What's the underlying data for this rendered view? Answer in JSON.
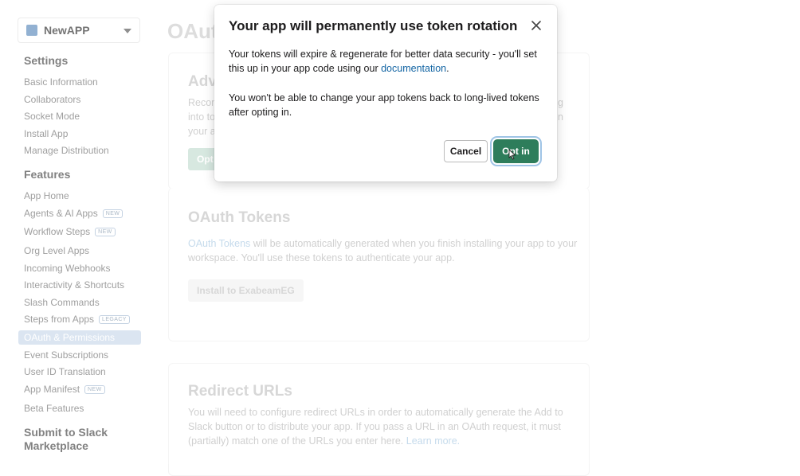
{
  "sidebar": {
    "app_name": "NewAPP",
    "settings_heading": "Settings",
    "settings_items": [
      "Basic Information",
      "Collaborators",
      "Socket Mode",
      "Install App",
      "Manage Distribution"
    ],
    "features_heading": "Features",
    "features_items": [
      {
        "label": "App Home",
        "badge": ""
      },
      {
        "label": "Agents & AI Apps",
        "badge": "NEW"
      },
      {
        "label": "Workflow Steps",
        "badge": "NEW"
      },
      {
        "label": "Org Level Apps",
        "badge": ""
      },
      {
        "label": "Incoming Webhooks",
        "badge": ""
      },
      {
        "label": "Interactivity & Shortcuts",
        "badge": ""
      },
      {
        "label": "Slash Commands",
        "badge": ""
      },
      {
        "label": "Steps from Apps",
        "badge": "LEGACY"
      },
      {
        "label": "OAuth & Permissions",
        "badge": ""
      },
      {
        "label": "Event Subscriptions",
        "badge": ""
      },
      {
        "label": "User ID Translation",
        "badge": ""
      },
      {
        "label": "App Manifest",
        "badge": "NEW"
      },
      {
        "label": "Beta Features",
        "badge": ""
      }
    ],
    "marketplace_heading_1": "Submit to Slack",
    "marketplace_heading_2": "Marketplace"
  },
  "main": {
    "title": "OAuth",
    "advanced_card": {
      "heading": "Adv",
      "text_lines": [
        "Recom",
        "into to",
        "your a"
      ],
      "right_fragments": [
        "g",
        "n"
      ],
      "button": "Opt"
    },
    "oauth_tokens": {
      "heading": "OAuth Tokens",
      "link": "OAuth Tokens",
      "text_line_1_rest": " will be automatically generated when you finish installing your app to your",
      "text_line_2": "workspace. You'll use these tokens to authenticate your app.",
      "button": "Install to ExabeamEG"
    },
    "redirect_urls": {
      "heading": "Redirect URLs",
      "line_1": "You will need to configure redirect URLs in order to automatically generate the Add to",
      "line_2": "Slack button or to distribute your app. If you pass a URL in an OAuth request, it must",
      "line_3": "(partially) match one of the URLs you enter here. ",
      "learn_more": "Learn more."
    }
  },
  "dialog": {
    "title": "Your app will permanently use token rotation",
    "p1_line1": "Your tokens will expire & regenerate for better data security - you'll set",
    "p1_line2_pre": "this up in your app code using our ",
    "p1_link": "documentation",
    "p1_line2_post": ".",
    "p2_line1": "You won't be able to change your app tokens back to long-lived tokens",
    "p2_line2": "after opting in.",
    "cancel": "Cancel",
    "confirm": "Opt in"
  },
  "colors": {
    "primary_button": "#2e7d5b",
    "link": "#1264a3",
    "active_nav": "#d3e0ee"
  },
  "icons": [
    "close-icon",
    "chevron-down-icon",
    "app-logo-icon",
    "cursor-icon"
  ]
}
